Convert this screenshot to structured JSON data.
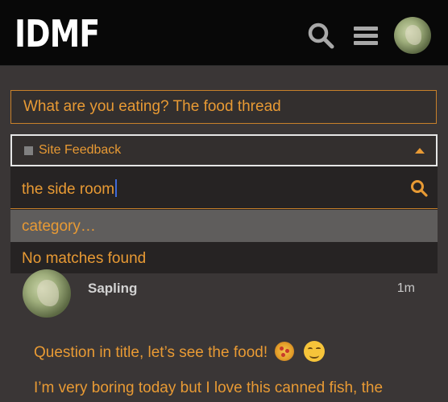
{
  "header": {
    "logo": "IDMF",
    "icons": [
      "search-icon",
      "hamburger-menu-icon",
      "user-avatar"
    ]
  },
  "composer": {
    "title_value": "What are you eating? The food thread",
    "category": {
      "selected": "Site Feedback",
      "swatch_color": "#808080"
    },
    "dropdown": {
      "search_value": "the side room",
      "hint": "category…",
      "no_matches": "No matches found"
    }
  },
  "post": {
    "username": "Sapling",
    "time": "1m",
    "line1": "Question in title, let’s see the food!",
    "line2": "I’m very boring today but I love this canned fish, the"
  },
  "colors": {
    "accent": "#e89a34",
    "header_bg": "#080808",
    "page_bg": "#3a3636",
    "dropdown_bg": "#262323",
    "hint_bg": "#5f5d5c"
  }
}
